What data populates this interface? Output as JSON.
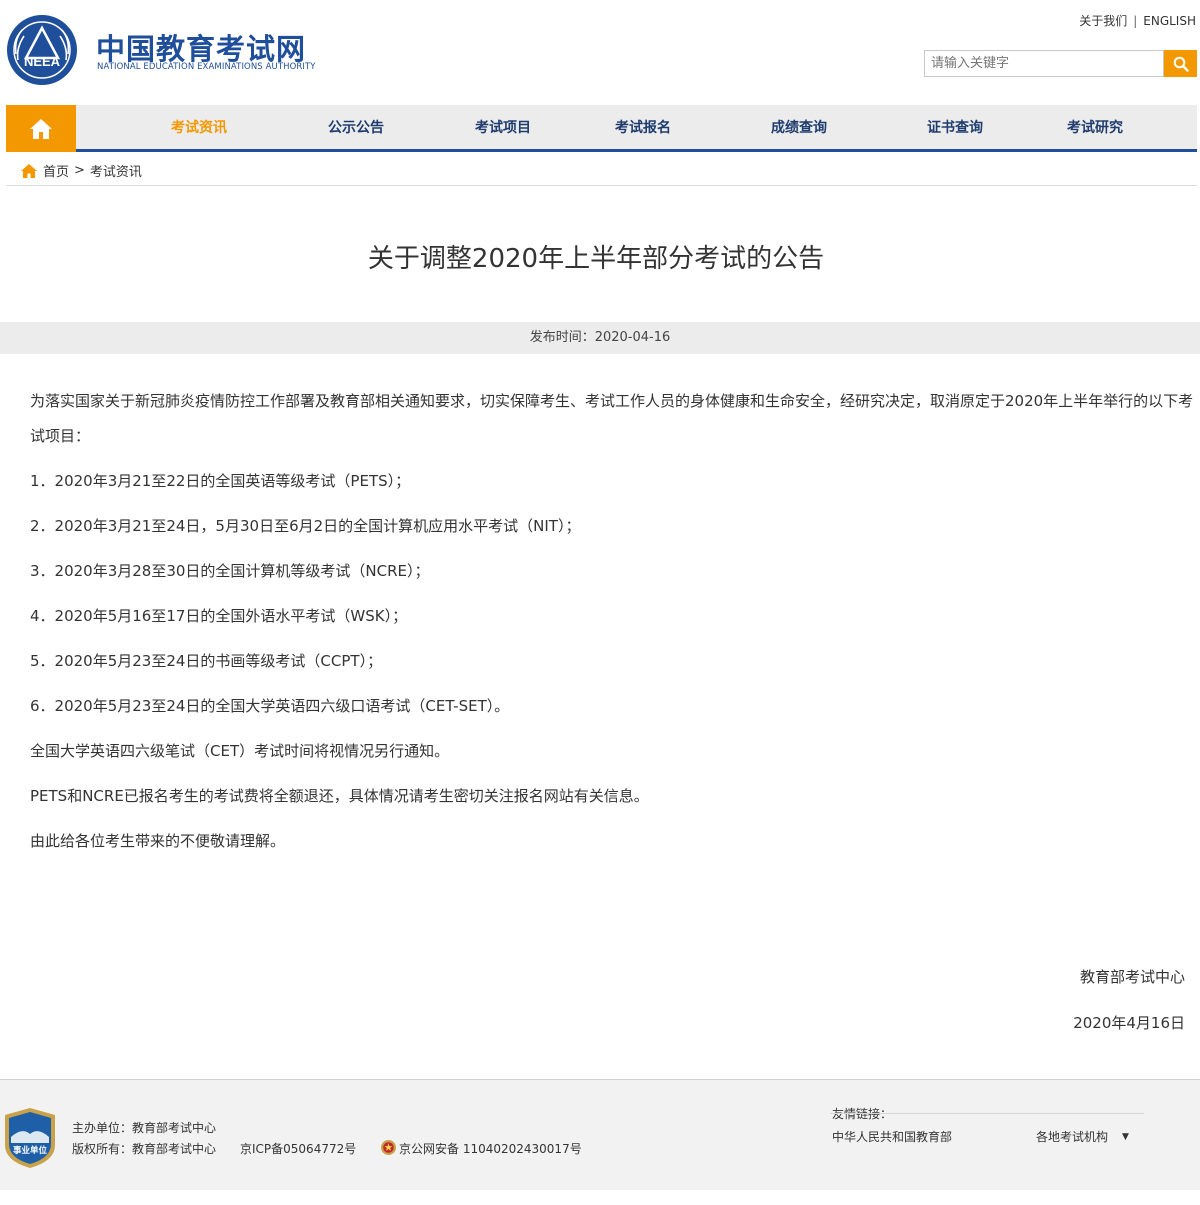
{
  "header": {
    "logo_cn": "中国教育考试网",
    "logo_en": "NATIONAL EDUCATION EXAMINATIONS AUTHORITY",
    "logo_emblem_text": "NEEA",
    "about_link": "关于我们",
    "divider": "|",
    "english_link": "ENGLISH",
    "search_placeholder": "请输入关键字",
    "search_icon": "search-icon"
  },
  "nav": {
    "home_icon": "home-icon",
    "items": [
      {
        "label": "考试资讯",
        "active": true
      },
      {
        "label": "公示公告"
      },
      {
        "label": "考试项目"
      },
      {
        "label": "考试报名"
      },
      {
        "label": "成绩查询"
      },
      {
        "label": "证书查询"
      },
      {
        "label": "考试研究"
      }
    ]
  },
  "breadcrumb": {
    "home": "首页",
    "separator": ">",
    "current": "考试资讯"
  },
  "article": {
    "title": "关于调整2020年上半年部分考试的公告",
    "publish_time": "发布时间：2020-04-16",
    "intro": "为落实国家关于新冠肺炎疫情防控工作部署及教育部相关通知要求，切实保障考生、考试工作人员的身体健康和生命安全，经研究决定，取消原定于2020年上半年举行的以下考试项目：",
    "items": [
      "1．2020年3月21至22日的全国英语等级考试（PETS）；",
      "2．2020年3月21至24日，5月30日至6月2日的全国计算机应用水平考试（NIT）；",
      "3．2020年3月28至30日的全国计算机等级考试（NCRE）；",
      "4．2020年5月16至17日的全国外语水平考试（WSK）；",
      "5．2020年5月23至24日的书画等级考试（CCPT）；",
      "6．2020年5月23至24日的全国大学英语四六级口语考试（CET-SET）。"
    ],
    "note1": "全国大学英语四六级笔试（CET）考试时间将视情况另行通知。",
    "note2": "PETS和NCRE已报名考生的考试费将全额退还，具体情况请考生密切关注报名网站有关信息。",
    "note3": "由此给各位考生带来的不便敬请理解。",
    "signature": "教育部考试中心",
    "date": "2020年4月16日"
  },
  "footer": {
    "badge_text": "事业单位",
    "sponsor": "主办单位：教育部考试中心",
    "copyright": "版权所有：教育部考试中心",
    "icp": "京ICP备05064772号",
    "police": "京公网安备 11040202430017号",
    "links_title": "友情链接：",
    "link_moe": "中华人民共和国教育部",
    "link_local": "各地考试机构",
    "dropdown_arrow": "▼"
  },
  "colors": {
    "brand_blue": "#1f4e9a",
    "accent_orange": "#f39800",
    "nav_bg": "#ececec"
  }
}
